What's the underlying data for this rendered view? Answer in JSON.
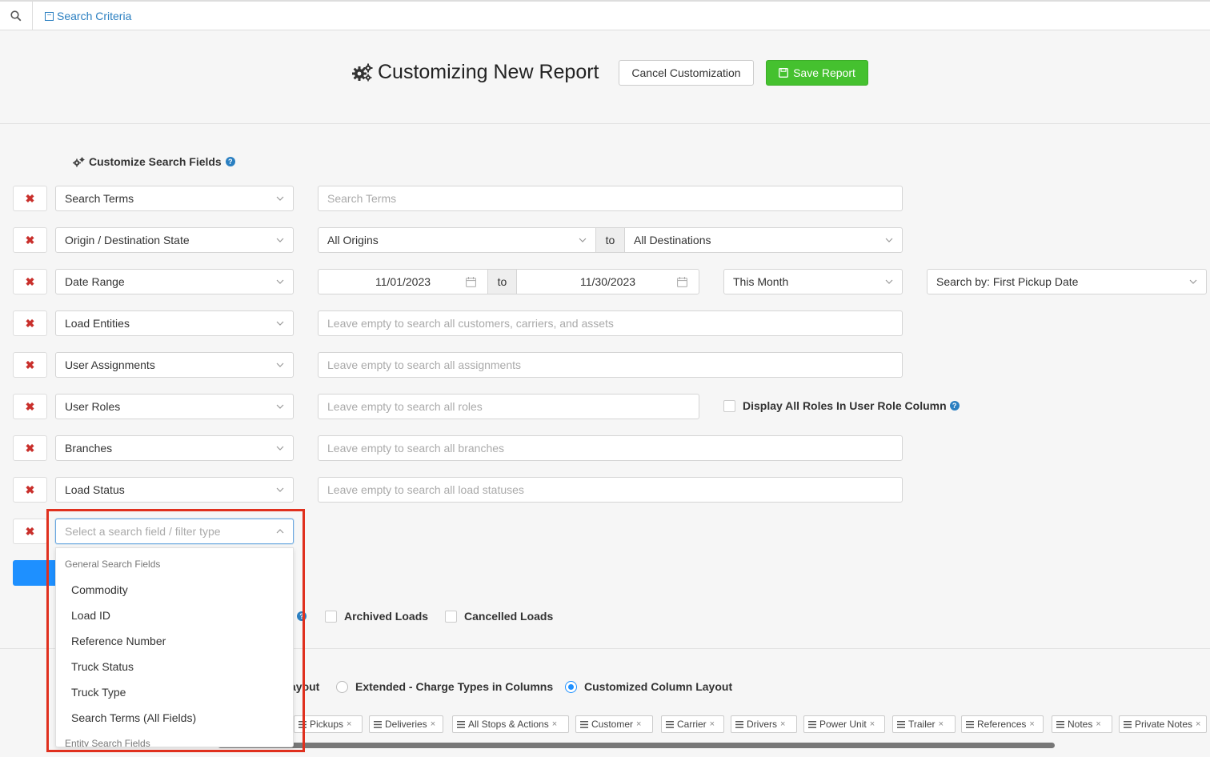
{
  "topbar": {
    "criteria_label": "Search Criteria"
  },
  "header": {
    "title": "Customizing New Report",
    "cancel_label": "Cancel Customization",
    "save_label": "Save Report"
  },
  "section": {
    "title": "Customize Search Fields"
  },
  "rows": [
    {
      "field": "Search Terms",
      "placeholder": "Search Terms"
    },
    {
      "field": "Origin / Destination State",
      "origin": "All Origins",
      "to": "to",
      "destination": "All Destinations"
    },
    {
      "field": "Date Range",
      "start": "11/01/2023",
      "to": "to",
      "end": "11/30/2023",
      "period": "This Month",
      "search_by": "Search by: First Pickup Date"
    },
    {
      "field": "Load Entities",
      "placeholder": "Leave empty to search all customers, carriers, and assets"
    },
    {
      "field": "User Assignments",
      "placeholder": "Leave empty to search all assignments"
    },
    {
      "field": "User Roles",
      "placeholder": "Leave empty to search all roles",
      "checkbox_label": "Display All Roles In User Role Column"
    },
    {
      "field": "Branches",
      "placeholder": "Leave empty to search all branches"
    },
    {
      "field": "Load Status",
      "placeholder": "Leave empty to search all load statuses"
    },
    {
      "field_placeholder": "Select a search field / filter type"
    }
  ],
  "remove_icon": "✖",
  "dropdown": {
    "group1": "General Search Fields",
    "items": [
      "Commodity",
      "Load ID",
      "Reference Number",
      "Truck Status",
      "Truck Type",
      "Search Terms (All Fields)"
    ],
    "group2": "Entity Search Fields"
  },
  "options": {
    "archived": "Archived Loads",
    "cancelled": "Cancelled Loads"
  },
  "layout": {
    "partial_label": "ayout",
    "extended": "Extended - Charge Types in Columns",
    "customized": "Customized Column Layout",
    "selected": "customized"
  },
  "columns": [
    "Pickups",
    "Deliveries",
    "All Stops & Actions",
    "Customer",
    "Carrier",
    "Drivers",
    "Power Unit",
    "Trailer",
    "References",
    "Notes",
    "Private Notes"
  ],
  "colors": {
    "accent": "#2a7fc1",
    "save": "#45c12f",
    "remove": "#c9302c",
    "highlight": "#e0301e",
    "primary": "#1e90ff"
  }
}
